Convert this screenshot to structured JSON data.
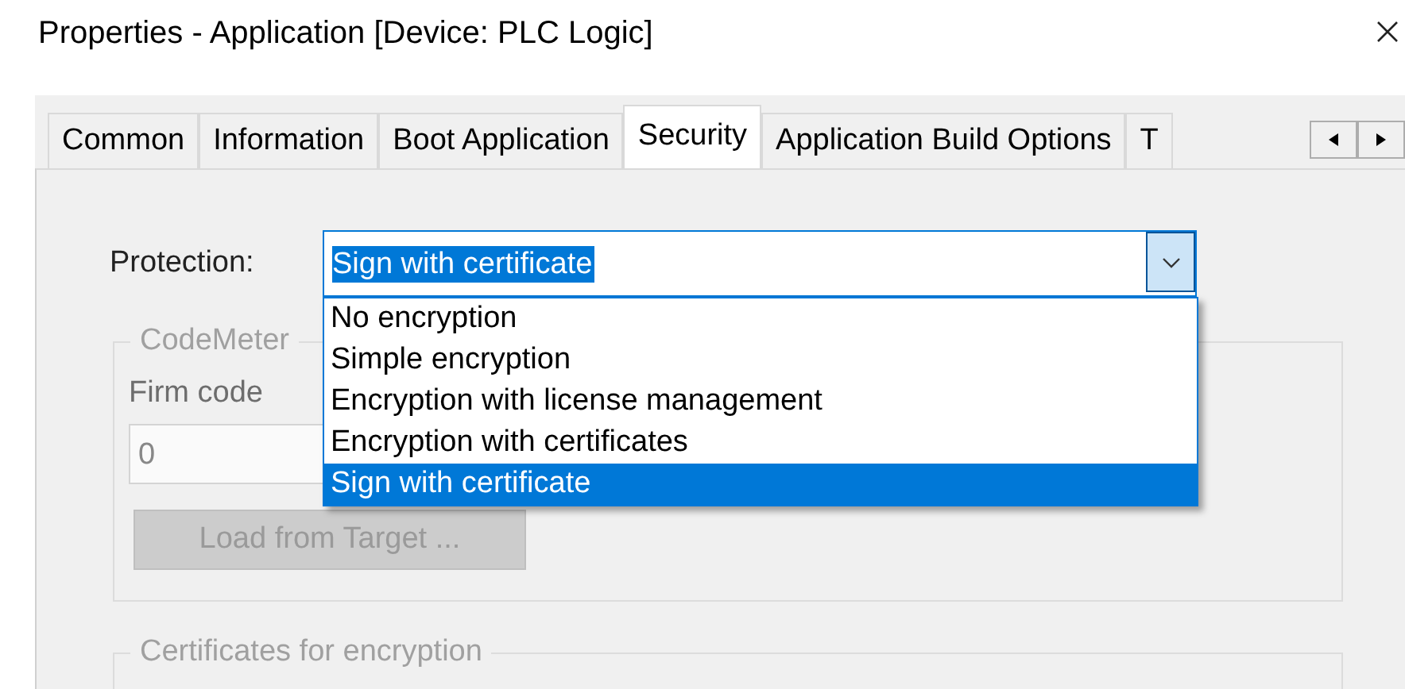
{
  "window": {
    "title": "Properties - Application [Device: PLC Logic]"
  },
  "tabs": [
    {
      "label": "Common",
      "selected": false
    },
    {
      "label": "Information",
      "selected": false
    },
    {
      "label": "Boot Application",
      "selected": false
    },
    {
      "label": "Security",
      "selected": true
    },
    {
      "label": "Application Build Options",
      "selected": false
    },
    {
      "label": "T",
      "selected": false
    }
  ],
  "protection": {
    "label": "Protection:",
    "value": "Sign with certificate",
    "expanded": true,
    "options": [
      {
        "label": "No encryption",
        "selected": false
      },
      {
        "label": "Simple encryption",
        "selected": false
      },
      {
        "label": "Encryption with license management",
        "selected": false
      },
      {
        "label": "Encryption with certificates",
        "selected": false
      },
      {
        "label": "Sign with certificate",
        "selected": true
      }
    ]
  },
  "codemeter": {
    "title": "CodeMeter",
    "firm_code_label": "Firm code",
    "firm_code": "0",
    "load_button": {
      "label": "Load from Target ...",
      "disabled": true
    }
  },
  "certificates": {
    "title": "Certificates for encryption"
  }
}
